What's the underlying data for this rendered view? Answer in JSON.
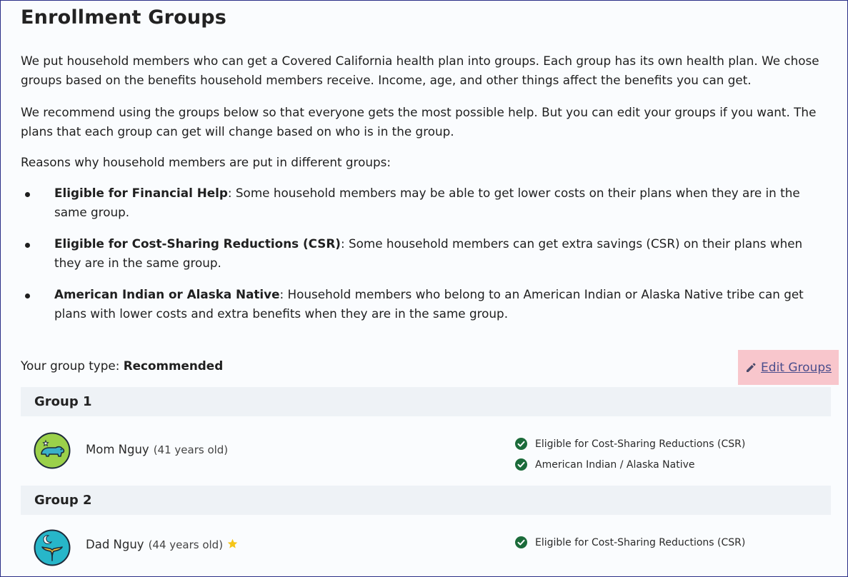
{
  "page": {
    "title": "Enrollment Groups",
    "paragraphs": [
      "We put household members who can get a Covered California health plan into groups. Each group has its own health plan. We chose groups based on the benefits household members receive. Income, age, and other things affect the benefits you can get.",
      "We recommend using the groups below so that everyone gets the most possible help. But you can edit your groups if you want. The plans that each group can get will change based on who is in the group.",
      "Reasons why household members are put in different groups:"
    ],
    "reasons": [
      {
        "term": "Eligible for Financial Help",
        "text": ": Some household members may be able to get lower costs on their plans when they are in the same group."
      },
      {
        "term": "Eligible for Cost-Sharing Reductions (CSR)",
        "text": ": Some household members can get extra savings (CSR) on their plans when they are in the same group."
      },
      {
        "term": "American Indian or Alaska Native",
        "text": ": Household members who belong to an American Indian or Alaska Native tribe can get plans with lower costs and extra benefits when they are in the same group."
      }
    ],
    "group_type_label": "Your group type: ",
    "group_type_value": "Recommended",
    "edit_groups_label": "Edit Groups"
  },
  "groups": [
    {
      "title": "Group 1",
      "member": {
        "name": "Mom Nguy",
        "age": "(41 years old)",
        "avatar": "bear-avatar-icon",
        "starred": false
      },
      "eligibility": [
        "Eligible for Cost-Sharing Reductions (CSR)",
        "American Indian / Alaska Native"
      ]
    },
    {
      "title": "Group 2",
      "member": {
        "name": "Dad Nguy",
        "age": "(44 years old)",
        "avatar": "whale-tail-avatar-icon",
        "starred": true
      },
      "eligibility": [
        "Eligible for Cost-Sharing Reductions (CSR)"
      ]
    }
  ],
  "colors": {
    "frame_border": "#2b2f87",
    "check_green": "#1b6b3a",
    "edit_highlight": "#f8c6cc",
    "star": "#f5c518",
    "bear_avatar_bg": "#9bd14a",
    "whale_avatar_bg": "#27b6c9"
  }
}
